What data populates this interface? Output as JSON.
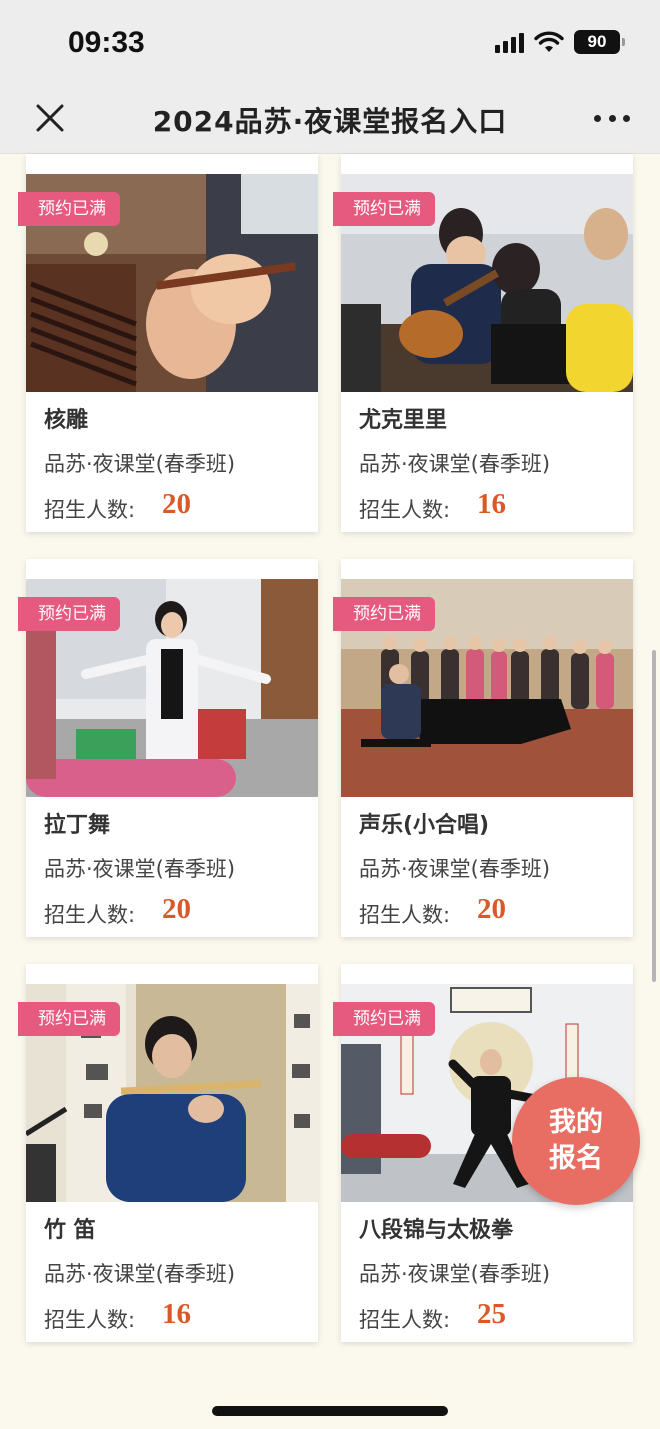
{
  "status_bar": {
    "time": "09:33",
    "battery": "90"
  },
  "nav": {
    "title": "2024品苏·夜课堂报名入口"
  },
  "courses": [
    {
      "name": "核雕",
      "subtitle": "品苏·夜课堂(春季班)",
      "count_label": "招生人数:",
      "count": "20",
      "badge": "预约已满"
    },
    {
      "name": "尤克里里",
      "subtitle": "品苏·夜课堂(春季班)",
      "count_label": "招生人数:",
      "count": "16",
      "badge": "预约已满"
    },
    {
      "name": "拉丁舞",
      "subtitle": "品苏·夜课堂(春季班)",
      "count_label": "招生人数:",
      "count": "20",
      "badge": "预约已满"
    },
    {
      "name": "声乐(小合唱)",
      "subtitle": "品苏·夜课堂(春季班)",
      "count_label": "招生人数:",
      "count": "20",
      "badge": "预约已满"
    },
    {
      "name": "竹 笛",
      "subtitle": "品苏·夜课堂(春季班)",
      "count_label": "招生人数:",
      "count": "16",
      "badge": "预约已满"
    },
    {
      "name": "八段锦与太极拳",
      "subtitle": "品苏·夜课堂(春季班)",
      "count_label": "招生人数:",
      "count": "25",
      "badge": "预约已满"
    }
  ],
  "fab": {
    "label": "我的\n报名"
  },
  "colors": {
    "badge": "#e65a80",
    "count": "#d75a28",
    "fab": "#e86e64",
    "background": "#fbf9ee"
  }
}
